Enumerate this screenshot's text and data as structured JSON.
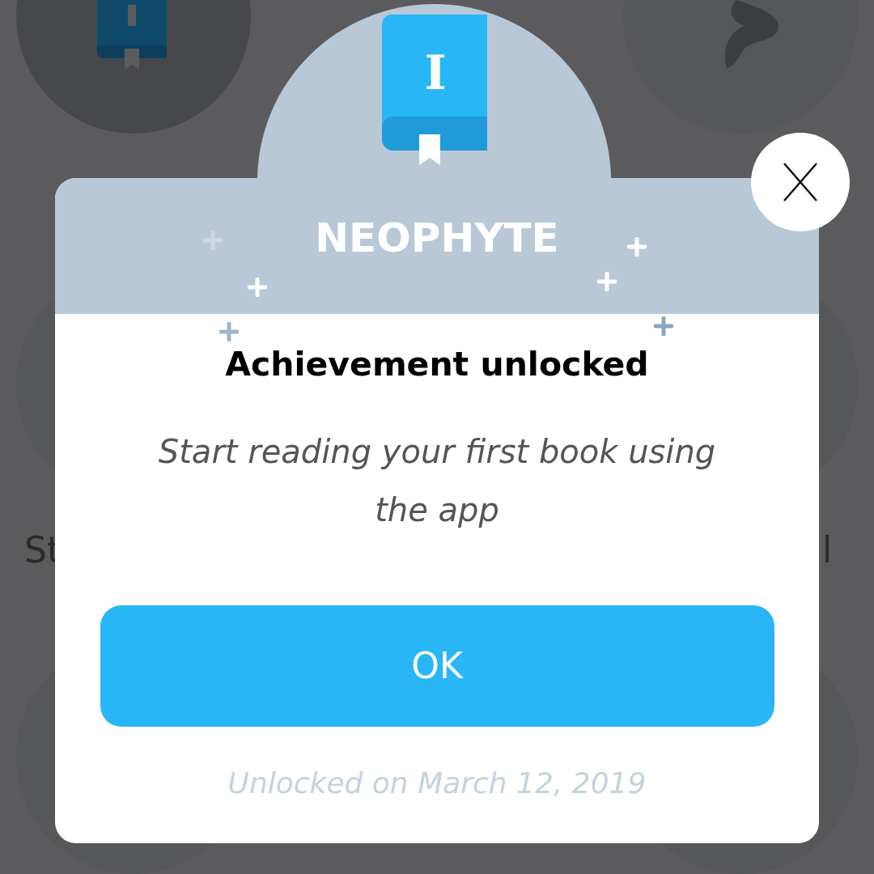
{
  "background": {
    "left_label": "St",
    "right_label": "l"
  },
  "dialog": {
    "badge_glyph": "I",
    "title": "NEOPHYTE",
    "heading": "Achievement unlocked",
    "description": "Start reading your first book using the app",
    "button": "OK",
    "footer": "Unlocked on March 12, 2019"
  }
}
